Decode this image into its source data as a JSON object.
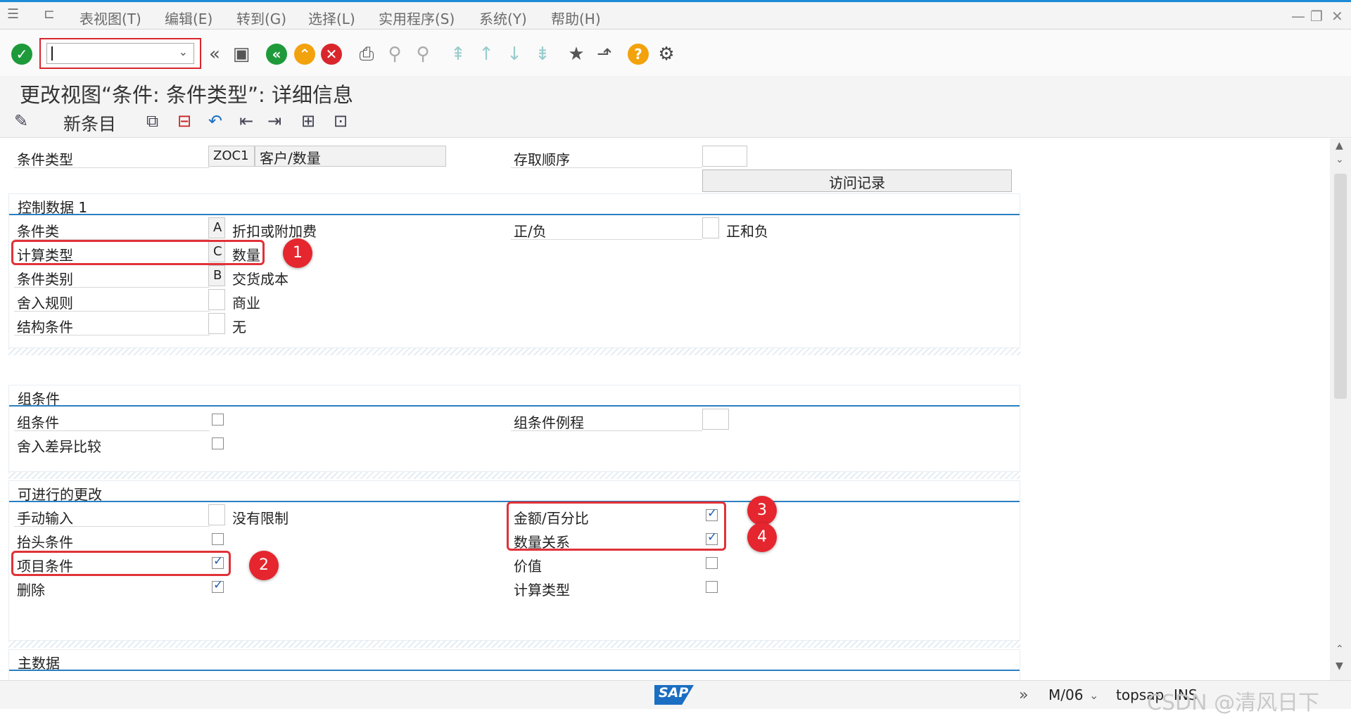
{
  "menu": {
    "items": [
      "表视图(T)",
      "编辑(E)",
      "转到(G)",
      "选择(L)",
      "实用程序(S)",
      "系统(Y)",
      "帮助(H)"
    ]
  },
  "title": "更改视图“条件: 条件类型”: 详细信息",
  "app_toolbar": {
    "new_entries": "新条目"
  },
  "header": {
    "cond_type_label": "条件类型",
    "cond_type_code": "ZOC1",
    "cond_type_desc": "客户/数量",
    "access_seq_label": "存取顺序",
    "access_seq_value": "",
    "records_button": "访问记录"
  },
  "control1": {
    "title": "控制数据 1",
    "cond_class_label": "条件类",
    "cond_class_code": "A",
    "cond_class_text": "折扣或附加费",
    "calc_type_label": "计算类型",
    "calc_type_code": "C",
    "calc_type_text": "数量",
    "cond_cat_label": "条件类别",
    "cond_cat_code": "B",
    "cond_cat_text": "交货成本",
    "rounding_label": "舍入规则",
    "rounding_code": "",
    "rounding_text": "商业",
    "struct_label": "结构条件",
    "struct_code": "",
    "struct_text": "无",
    "plus_minus_label": "正/负",
    "plus_minus_code": "",
    "plus_minus_text": "正和负"
  },
  "group": {
    "title": "组条件",
    "group_cond_label": "组条件",
    "group_cond_checked": false,
    "round_diff_label": "舍入差异比较",
    "round_diff_checked": false,
    "group_routine_label": "组条件例程",
    "group_routine_value": ""
  },
  "changes": {
    "title": "可进行的更改",
    "manual_label": "手动输入",
    "manual_code": "",
    "manual_text": "没有限制",
    "header_cond_label": "抬头条件",
    "header_cond_checked": false,
    "item_cond_label": "项目条件",
    "item_cond_checked": true,
    "delete_label": "删除",
    "delete_checked": true,
    "amount_pct_label": "金额/百分比",
    "amount_pct_checked": true,
    "qty_rel_label": "数量关系",
    "qty_rel_checked": true,
    "value_label": "价值",
    "value_checked": false,
    "calc_type_label": "计算类型",
    "calc_type_checked": false
  },
  "master": {
    "title": "主数据"
  },
  "badges": [
    "1",
    "2",
    "3",
    "4"
  ],
  "status": {
    "client": "M/06",
    "server": "topsap",
    "mode": "INS",
    "logo": "SAP",
    "watermark": "CSDN @清风日下"
  },
  "colors": {
    "accent": "#2a7fc0",
    "highlight": "#e03238",
    "ok_green": "#1e9a3a",
    "cancel_red": "#d9262c",
    "help_orange": "#f2a20c"
  }
}
